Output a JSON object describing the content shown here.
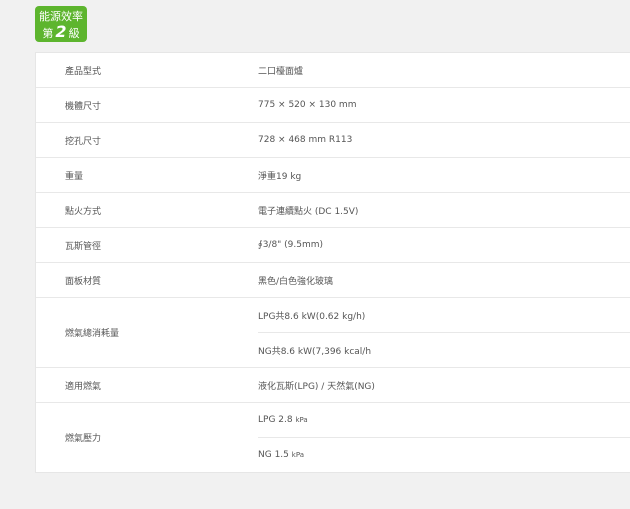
{
  "badge": {
    "line1": "能源效率",
    "prefix": "第",
    "level": "2",
    "suffix": "級"
  },
  "specs": {
    "model_label": "產品型式",
    "model_value": "二口檯面爐",
    "size_label": "機體尺寸",
    "size_value": "775 × 520 × 130 mm",
    "cutout_label": "挖孔尺寸",
    "cutout_value": "728 × 468 mm R113",
    "weight_label": "重量",
    "weight_value": "淨重19 kg",
    "ignition_label": "點火方式",
    "ignition_value": "電子連續點火 (DC 1.5V)",
    "pipe_label": "瓦斯管徑",
    "pipe_value": "∮3/8\" (9.5mm)",
    "panel_label": "面板材質",
    "panel_value": "黑色/白色強化玻璃",
    "consumption_label": "燃氣總消耗量",
    "consumption_lpg": "LPG共8.6 kW(0.62 kg/h)",
    "consumption_ng": "NG共8.6 kW(7,396 kcal/h",
    "fuel_label": "適用燃氣",
    "fuel_value": "液化瓦斯(LPG) / 天然氣(NG)",
    "pressure_label": "燃氣壓力",
    "pressure_lpg_value": "LPG 2.8",
    "pressure_lpg_unit": "kPa",
    "pressure_ng_value": "NG 1.5",
    "pressure_ng_unit": "kPa"
  }
}
